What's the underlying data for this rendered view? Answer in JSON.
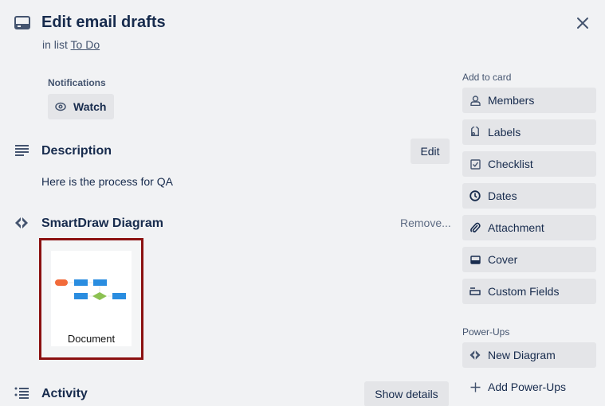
{
  "card": {
    "title": "Edit email drafts",
    "list_prefix": "in list ",
    "list_name": "To Do"
  },
  "notifications": {
    "label": "Notifications",
    "watch_label": "Watch"
  },
  "description": {
    "heading": "Description",
    "edit_label": "Edit",
    "text": "Here is the process for QA"
  },
  "smartdraw": {
    "heading": "SmartDraw Diagram",
    "remove_label": "Remove...",
    "document_caption": "Document"
  },
  "activity": {
    "heading": "Activity",
    "show_details_label": "Show details"
  },
  "sidebar": {
    "add_to_card_label": "Add to card",
    "add_to_card": [
      {
        "label": "Members",
        "icon": "person-icon"
      },
      {
        "label": "Labels",
        "icon": "tag-icon"
      },
      {
        "label": "Checklist",
        "icon": "checkbox-icon"
      },
      {
        "label": "Dates",
        "icon": "clock-icon"
      },
      {
        "label": "Attachment",
        "icon": "paperclip-icon"
      },
      {
        "label": "Cover",
        "icon": "cover-icon"
      },
      {
        "label": "Custom Fields",
        "icon": "custom-fields-icon"
      }
    ],
    "powerups_label": "Power-Ups",
    "powerups": [
      {
        "label": "New Diagram",
        "icon": "smartdraw-icon"
      },
      {
        "label": "Add Power-Ups",
        "icon": "plus-icon"
      }
    ]
  },
  "colors": {
    "background": "#f1f2f4",
    "button": "#e4e5e8",
    "text": "#172b4d",
    "thumbnail_border": "#8b1111",
    "diagram_orange": "#f26b3a",
    "diagram_blue": "#2a8de0",
    "diagram_green": "#8cc152"
  }
}
